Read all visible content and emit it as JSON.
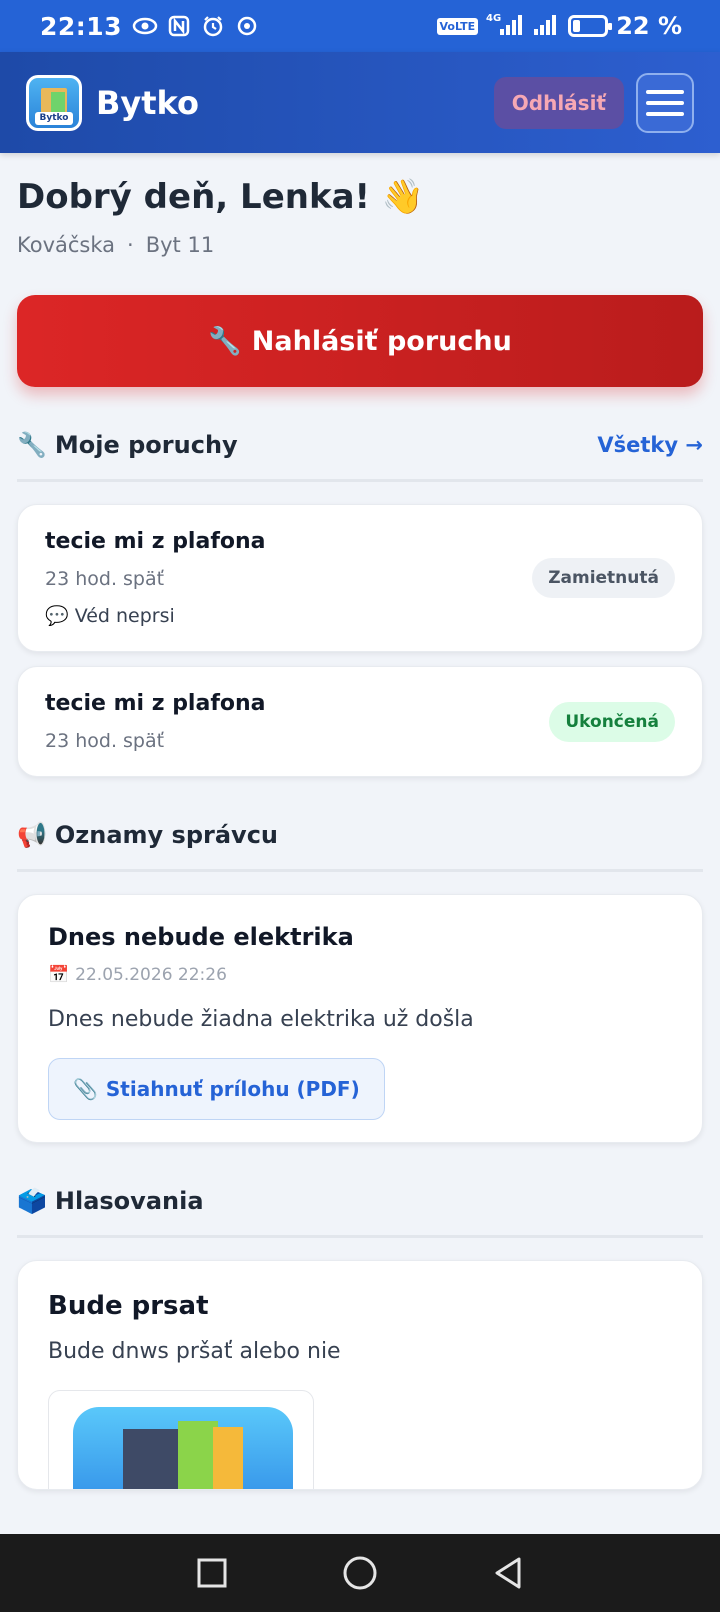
{
  "status_bar": {
    "time": "22:13",
    "left_icons": [
      "eye-icon",
      "nfc-icon",
      "alarm-icon",
      "chrome-icon"
    ],
    "volte": "VoLTE",
    "network": "4G",
    "battery": "22 %",
    "battery_level": 0.22
  },
  "header": {
    "app_name": "Bytko",
    "logo_text": "Bytko",
    "logout_label": "Odhlásiť",
    "menu_icon": "hamburger-icon"
  },
  "greeting": {
    "title": "Dobrý deň, Lenka! 👋",
    "street": "Kováčska",
    "separator": "·",
    "apartment": "Byt 11"
  },
  "report_button": {
    "icon": "🔧",
    "label": "Nahlásiť poruchu"
  },
  "faults_section": {
    "icon": "🔧",
    "title": "Moje poruchy",
    "link": "Všetky →",
    "items": [
      {
        "title": "tecie mi z plafona",
        "time": "23 hod. späť",
        "note": "💬 Véd neprsi",
        "status": "Zamietnutá"
      },
      {
        "title": "tecie mi z plafona",
        "time": "23 hod. späť",
        "status": "Ukončená"
      }
    ]
  },
  "announcements_section": {
    "icon": "📢",
    "title": "Oznamy správcu",
    "items": [
      {
        "title": "Dnes nebude elektrika",
        "date_icon": "📅",
        "date": "22.05.2026 22:26",
        "text": "Dnes nebude žiadna elektrika už došla",
        "attachment_icon": "📎",
        "attachment_label": "Stiahnuť prílohu (PDF)"
      }
    ]
  },
  "polls_section": {
    "icon": "🗳️",
    "title": "Hlasovania",
    "items": [
      {
        "title": "Bude prsat",
        "text": "Bude dnws pršať alebo nie",
        "image": "building-illustration"
      }
    ]
  },
  "nav_bar": {
    "buttons": [
      "recent-apps-icon",
      "home-icon",
      "back-icon"
    ]
  }
}
